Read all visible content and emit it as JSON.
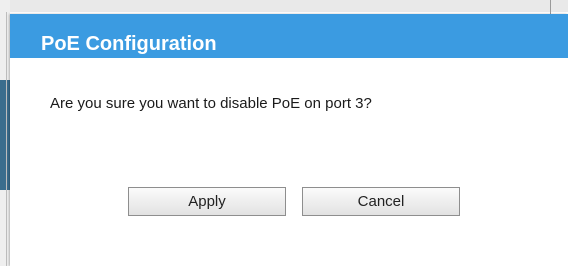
{
  "dialog": {
    "title": "PoE Configuration",
    "message": "Are you sure you want to disable PoE on port 3?",
    "apply_label": "Apply",
    "cancel_label": "Cancel"
  },
  "colors": {
    "header_bg": "#3b9be1",
    "header_text": "#ffffff",
    "background_accent": "#3a6d8d"
  }
}
